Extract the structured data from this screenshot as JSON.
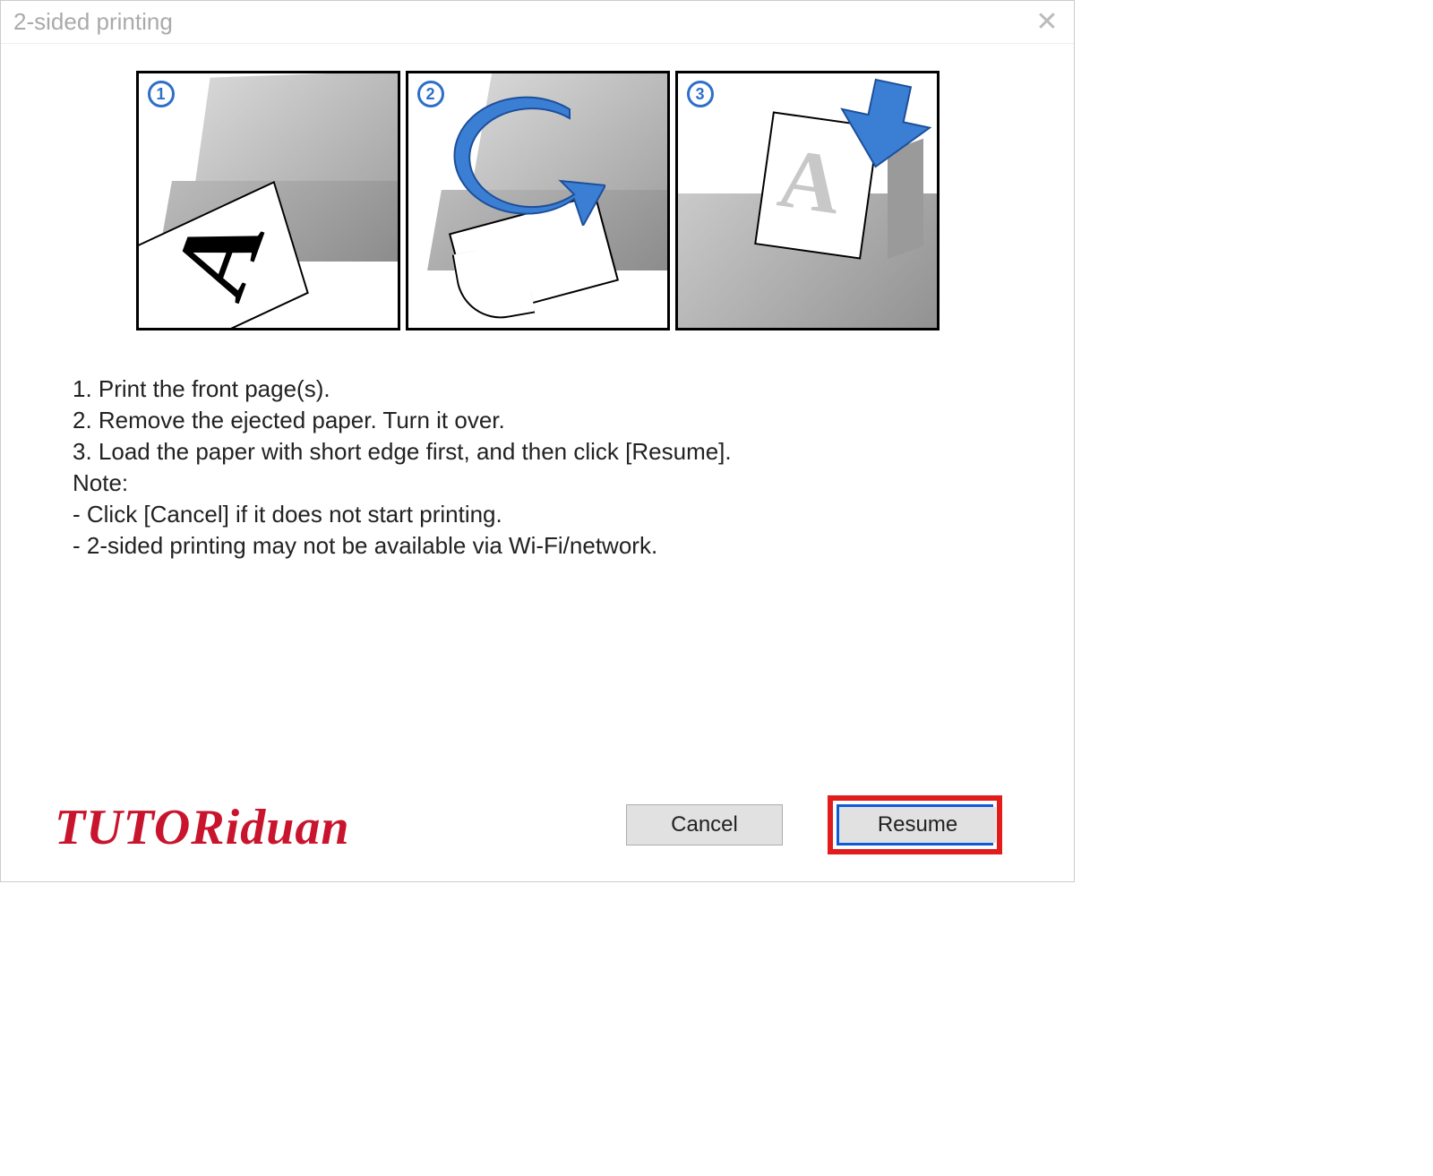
{
  "dialog": {
    "title": "2-sided printing"
  },
  "steps": {
    "s1": "1",
    "s2": "2",
    "s3": "3"
  },
  "instructions": {
    "line1": "1. Print the front page(s).",
    "line2": "2. Remove the ejected paper. Turn it over.",
    "line3": "3. Load the paper with short edge first, and then click [Resume].",
    "note_label": "Note:",
    "note1": "- Click [Cancel] if it does not start printing.",
    "note2": "- 2-sided printing may not be available via Wi-Fi/network."
  },
  "buttons": {
    "cancel": "Cancel",
    "resume": "Resume"
  },
  "watermark": "TUTORiduan"
}
